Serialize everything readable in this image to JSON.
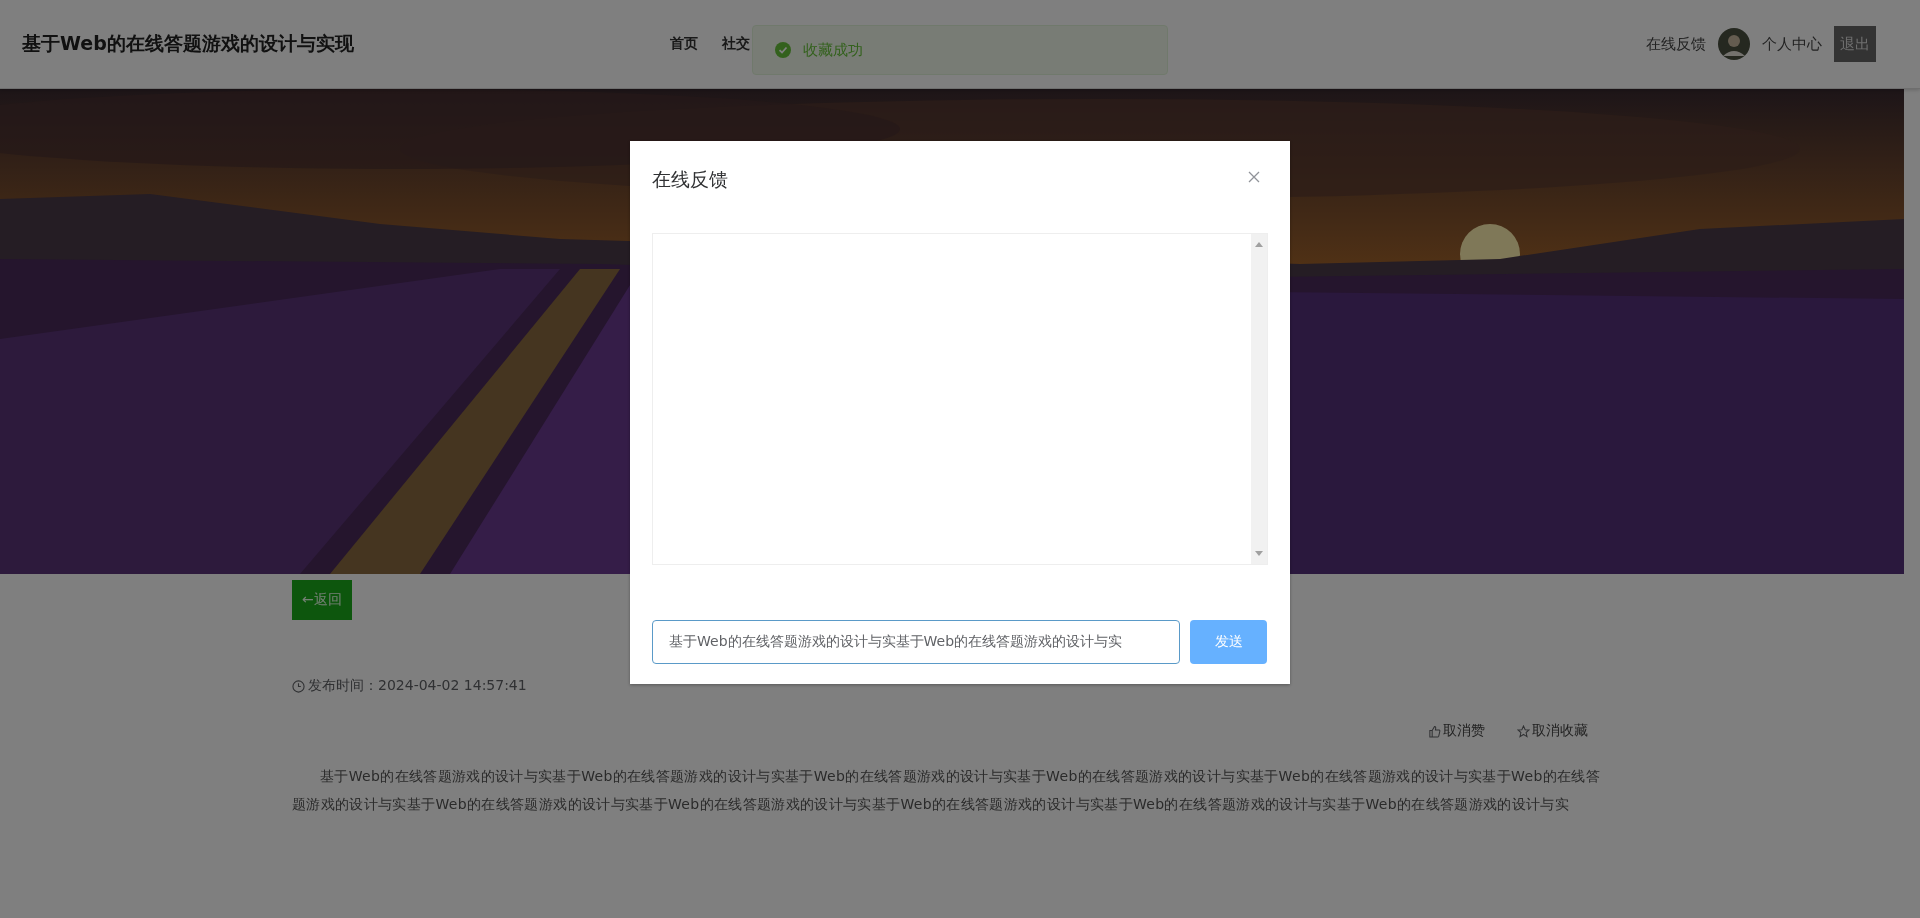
{
  "header": {
    "title": "基于Web的在线答题游戏的设计与实现",
    "nav": [
      {
        "label": "首页"
      },
      {
        "label": "社交"
      }
    ],
    "feedback_link": "在线反馈",
    "profile_link": "个人中心",
    "logout_button": "退出"
  },
  "toast": {
    "kind": "success",
    "message": "收藏成功"
  },
  "article": {
    "back_button": "←返回",
    "publish_time": "发布时间：2024-04-02 14:57:41",
    "actions": [
      {
        "kind": "like",
        "label": "取消赞"
      },
      {
        "kind": "favorite",
        "label": "取消收藏"
      }
    ],
    "body": "基于Web的在线答题游戏的设计与实基于Web的在线答题游戏的设计与实基于Web的在线答题游戏的设计与实基于Web的在线答题游戏的设计与实基于Web的在线答题游戏的设计与实基于Web的在线答题游戏的设计与实基于Web的在线答题游戏的设计与实基于Web的在线答题游戏的设计与实基于Web的在线答题游戏的设计与实基于Web的在线答题游戏的设计与实基于Web的在线答题游戏的设计与实"
  },
  "dialog": {
    "title": "在线反馈",
    "input_value": "基于Web的在线答题游戏的设计与实基于Web的在线答题游戏的设计与实",
    "send_button": "发送"
  }
}
